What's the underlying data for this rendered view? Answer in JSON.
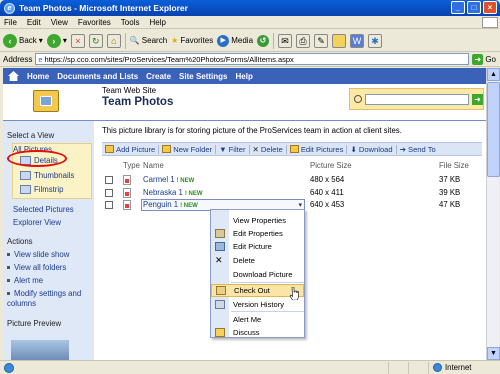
{
  "window": {
    "title": "Team Photos - Microsoft Internet Explorer"
  },
  "menu": [
    "File",
    "Edit",
    "View",
    "Favorites",
    "Tools",
    "Help"
  ],
  "toolbar": {
    "back": "Back",
    "search": "Search",
    "favorites": "Favorites",
    "media": "Media"
  },
  "address": {
    "label": "Address",
    "url": "https://sp.cco.com/sites/ProServices/Team%20Photos/Forms/AllItems.aspx",
    "go": "Go"
  },
  "topnav": [
    "Home",
    "Documents and Lists",
    "Create",
    "Site Settings",
    "Help"
  ],
  "site": {
    "subtitle": "Team Web Site",
    "title": "Team Photos"
  },
  "leftnav": {
    "select_view": "Select a View",
    "all_pictures": "All Pictures",
    "views": [
      "Details",
      "Thumbnails",
      "Filmstrip"
    ],
    "selected_pictures": "Selected Pictures",
    "explorer_view": "Explorer View",
    "actions_head": "Actions",
    "actions": [
      "View slide show",
      "View all folders",
      "Alert me",
      "Modify settings and columns"
    ],
    "picture_preview": "Picture Preview"
  },
  "description": "This picture library is for storing picture of the ProServices team in action at client sites.",
  "list_toolbar": [
    "Add Picture",
    "New Folder",
    "Filter",
    "Delete",
    "Edit Pictures",
    "Download",
    "Send To"
  ],
  "columns": {
    "type": "Type",
    "name": "Name",
    "picture_size": "Picture Size",
    "file_size": "File Size"
  },
  "rows": [
    {
      "name": "Carmel 1",
      "badge": "! NEW",
      "picture_size": "480 x 564",
      "file_size": "37 KB"
    },
    {
      "name": "Nebraska 1",
      "badge": "! NEW",
      "picture_size": "640 x 411",
      "file_size": "39 KB"
    },
    {
      "name": "Penguin 1",
      "badge": "! NEW",
      "picture_size": "640 x 453",
      "file_size": "47 KB"
    }
  ],
  "context_menu": [
    "View Properties",
    "Edit Properties",
    "Edit Picture",
    "Delete",
    "Download Picture",
    "Check Out",
    "Version History",
    "Alert Me",
    "Discuss"
  ],
  "status": {
    "zone": "Internet"
  }
}
